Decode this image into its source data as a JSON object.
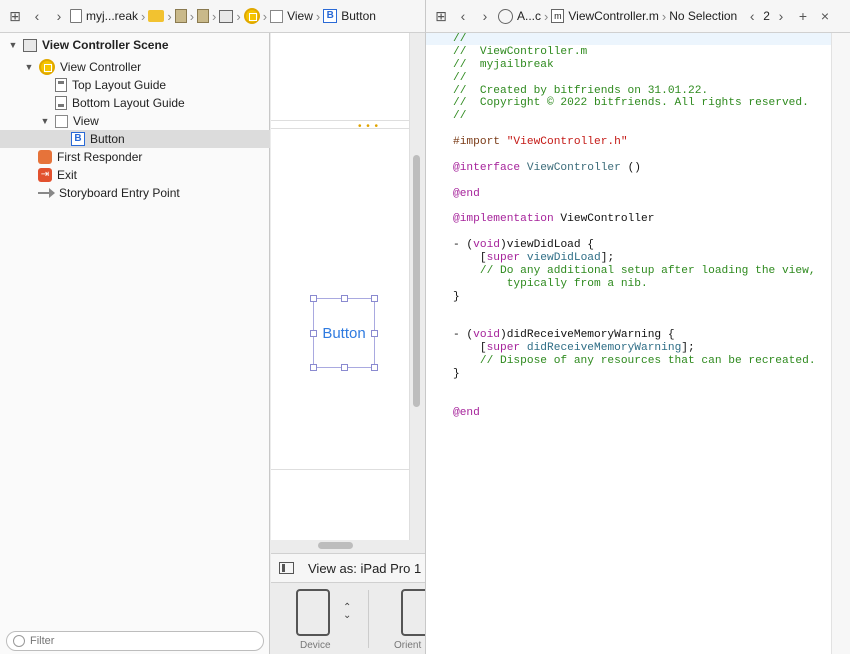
{
  "left_jumpbar": {
    "crumbs": [
      "myj...reak",
      "View",
      "Button"
    ]
  },
  "right_jumpbar": {
    "assistant_label": "A...c",
    "file_name": "ViewController.m",
    "selection": "No Selection",
    "counter": "2"
  },
  "outline": {
    "items": [
      {
        "label": "View Controller Scene"
      },
      {
        "label": "View Controller"
      },
      {
        "label": "Top Layout Guide"
      },
      {
        "label": "Bottom Layout Guide"
      },
      {
        "label": "View"
      },
      {
        "label": "Button"
      },
      {
        "label": "First Responder"
      },
      {
        "label": "Exit"
      },
      {
        "label": "Storyboard Entry Point"
      }
    ],
    "filter_placeholder": "Filter"
  },
  "canvas": {
    "button_text": "Button",
    "view_as": "View as: iPad Pro 1",
    "device_label": "Device",
    "orientation_label": "Orient"
  },
  "code": {
    "lines": [
      [
        {
          "t": "//",
          "c": "cmt"
        }
      ],
      [
        {
          "t": "//  ViewController.m",
          "c": "cmt"
        }
      ],
      [
        {
          "t": "//  myjailbreak",
          "c": "cmt"
        }
      ],
      [
        {
          "t": "//",
          "c": "cmt"
        }
      ],
      [
        {
          "t": "//  Created by bitfriends on 31.01.22.",
          "c": "cmt"
        }
      ],
      [
        {
          "t": "//  Copyright © 2022 bitfriends. All rights reserved.",
          "c": "cmt"
        }
      ],
      [
        {
          "t": "//",
          "c": "cmt"
        }
      ],
      [],
      [
        {
          "t": "#import ",
          "c": "pre"
        },
        {
          "t": "\"ViewController.h\"",
          "c": "str"
        }
      ],
      [],
      [
        {
          "t": "@interface",
          "c": "kw"
        },
        {
          "t": " ",
          "c": "plain"
        },
        {
          "t": "ViewController",
          "c": "cls"
        },
        {
          "t": " ()",
          "c": "plain"
        }
      ],
      [],
      [
        {
          "t": "@end",
          "c": "kw"
        }
      ],
      [],
      [
        {
          "t": "@implementation",
          "c": "kw"
        },
        {
          "t": " ViewController",
          "c": "plain"
        }
      ],
      [],
      [
        {
          "t": "- (",
          "c": "plain"
        },
        {
          "t": "void",
          "c": "kw"
        },
        {
          "t": ")viewDidLoad {",
          "c": "plain"
        }
      ],
      [
        {
          "t": "    [",
          "c": "plain"
        },
        {
          "t": "super",
          "c": "kw"
        },
        {
          "t": " ",
          "c": "plain"
        },
        {
          "t": "viewDidLoad",
          "c": "mth"
        },
        {
          "t": "];",
          "c": "plain"
        }
      ],
      [
        {
          "t": "    // Do any additional setup after loading the view,",
          "c": "cmt"
        }
      ],
      [
        {
          "t": "        typically from a nib.",
          "c": "cmt"
        }
      ],
      [
        {
          "t": "}",
          "c": "plain"
        }
      ],
      [],
      [],
      [
        {
          "t": "- (",
          "c": "plain"
        },
        {
          "t": "void",
          "c": "kw"
        },
        {
          "t": ")didReceiveMemoryWarning {",
          "c": "plain"
        }
      ],
      [
        {
          "t": "    [",
          "c": "plain"
        },
        {
          "t": "super",
          "c": "kw"
        },
        {
          "t": " ",
          "c": "plain"
        },
        {
          "t": "didReceiveMemoryWarning",
          "c": "mth"
        },
        {
          "t": "];",
          "c": "plain"
        }
      ],
      [
        {
          "t": "    // Dispose of any resources that can be recreated.",
          "c": "cmt"
        }
      ],
      [
        {
          "t": "}",
          "c": "plain"
        }
      ],
      [],
      [],
      [
        {
          "t": "@end",
          "c": "kw"
        }
      ]
    ]
  },
  "colors": {
    "comment": "#2e8a1e",
    "keyword": "#a6239b",
    "string": "#c41a16",
    "button_text": "#2f7be0",
    "selection_row": "#dcdcdc"
  }
}
